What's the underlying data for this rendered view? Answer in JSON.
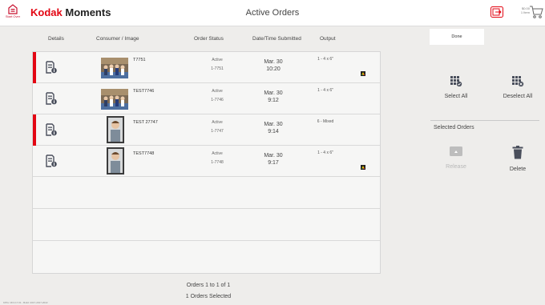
{
  "header": {
    "home_label": "Start Over",
    "brand_kodak": "Kodak",
    "brand_moments": "Moments",
    "title": "Active Orders",
    "cart_amount": "$0.00",
    "cart_items": "1 Item"
  },
  "columns": {
    "details": "Details",
    "consumer": "Consumer / Image",
    "status": "Order Status",
    "datetime": "Date/Time Submitted",
    "output": "Output"
  },
  "orders": [
    {
      "name": "T7751",
      "status": "Active",
      "order_no": "1-7751",
      "date": "Mar. 30",
      "time": "10:20",
      "output": "1 - 4 x 6\"",
      "selected": true
    },
    {
      "name": "TEST7746",
      "status": "Active",
      "order_no": "1-7746",
      "date": "Mar. 30",
      "time": "9:12",
      "output": "1 - 4 x 6\"",
      "selected": false
    },
    {
      "name": "TEST 27747",
      "status": "Active",
      "order_no": "1-7747",
      "date": "Mar. 30",
      "time": "9:14",
      "output": "6 - Mixed",
      "selected": true
    },
    {
      "name": "TEST7748",
      "status": "Active",
      "order_no": "1-7748",
      "date": "Mar. 30",
      "time": "9:17",
      "output": "1 - 4 x 6\"",
      "selected": false
    }
  ],
  "footer": {
    "range": "Orders 1 to 1 of 1",
    "selected_count": "1 Orders Selected",
    "version": "KPKv 18.3.17.01 - Build: 2017-2017-2022"
  },
  "actions": {
    "done": "Done",
    "select_all": "Select All",
    "deselect_all": "Deselect All",
    "selected_orders": "Selected Orders",
    "release": "Release",
    "delete": "Delete"
  },
  "colors": {
    "accent": "#e30613",
    "icon": "#4a4f5c"
  }
}
